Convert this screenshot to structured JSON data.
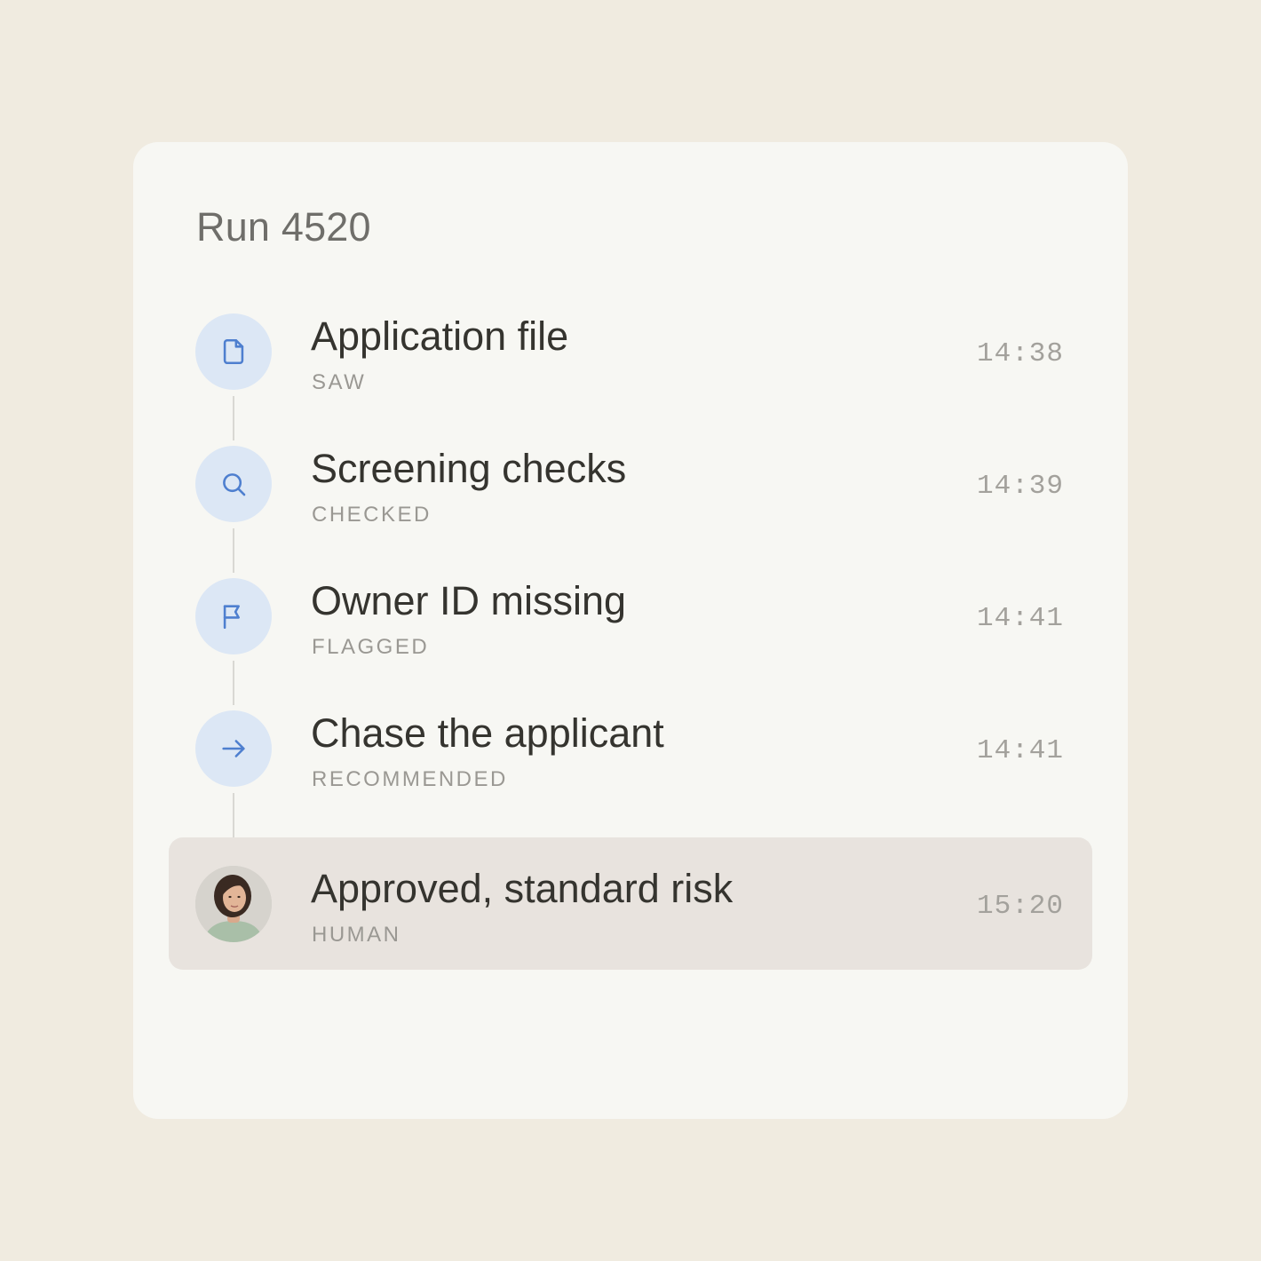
{
  "run": {
    "title": "Run 4520"
  },
  "steps": [
    {
      "title": "Application file",
      "status": "SAW",
      "time": "14:38",
      "icon": "file-icon"
    },
    {
      "title": "Screening checks",
      "status": "CHECKED",
      "time": "14:39",
      "icon": "search-icon"
    },
    {
      "title": "Owner ID missing",
      "status": "FLAGGED",
      "time": "14:41",
      "icon": "flag-icon"
    },
    {
      "title": "Chase the applicant",
      "status": "RECOMMENDED",
      "time": "14:41",
      "icon": "arrow-right-icon"
    },
    {
      "title": "Approved, standard risk",
      "status": "HUMAN",
      "time": "15:20",
      "icon": "avatar"
    }
  ],
  "colors": {
    "page_background": "#f0ebe0",
    "card_background": "#f7f7f3",
    "icon_background": "#dce7f5",
    "icon_stroke": "#4e7fcf",
    "highlight_row": "#e8e3de"
  }
}
